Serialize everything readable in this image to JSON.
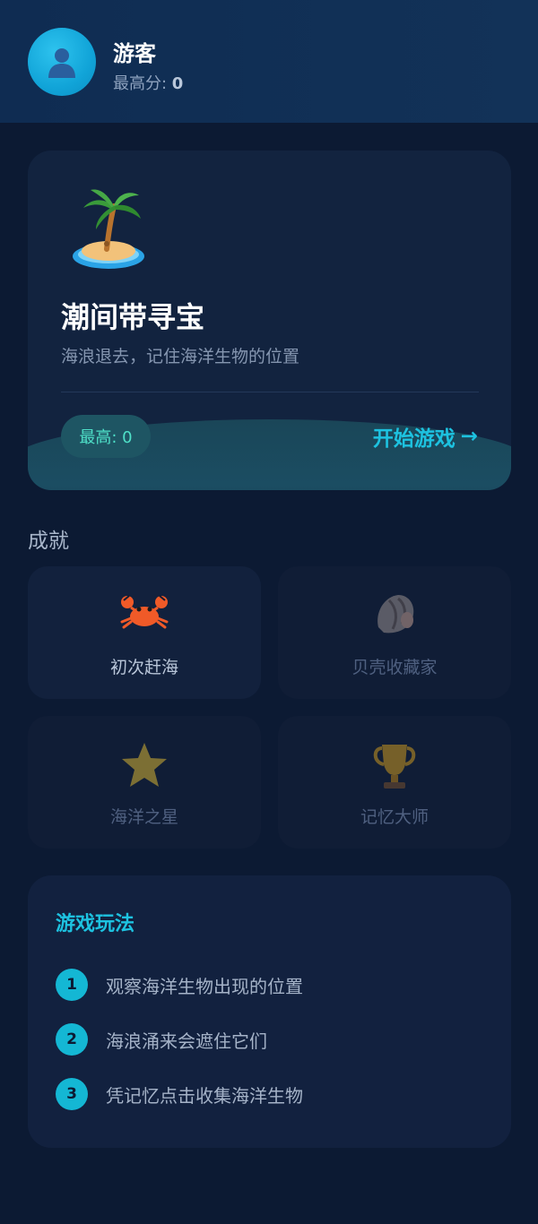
{
  "user": {
    "name": "游客",
    "best_label": "最高分: ",
    "best_value": "0"
  },
  "game": {
    "title": "潮间带寻宝",
    "description": "海浪退去，记住海洋生物的位置",
    "record": "最高: 0",
    "start_label": "开始游戏",
    "start_arrow": "→",
    "icon": "palm-island-icon"
  },
  "achievements": {
    "title": "成就",
    "items": [
      {
        "label": "初次赶海",
        "icon": "crab-icon",
        "unlocked": true
      },
      {
        "label": "贝壳收藏家",
        "icon": "shell-icon",
        "unlocked": false
      },
      {
        "label": "海洋之星",
        "icon": "star-icon",
        "unlocked": false
      },
      {
        "label": "记忆大师",
        "icon": "trophy-icon",
        "unlocked": false
      }
    ]
  },
  "howto": {
    "title": "游戏玩法",
    "steps": [
      {
        "num": "1",
        "text": "观察海洋生物出现的位置"
      },
      {
        "num": "2",
        "text": "海浪涌来会遮住它们"
      },
      {
        "num": "3",
        "text": "凭记忆点击收集海洋生物"
      }
    ]
  },
  "colors": {
    "background": "#0c1a33",
    "accent": "#1dc2e0",
    "record": "#4fe0c8"
  }
}
